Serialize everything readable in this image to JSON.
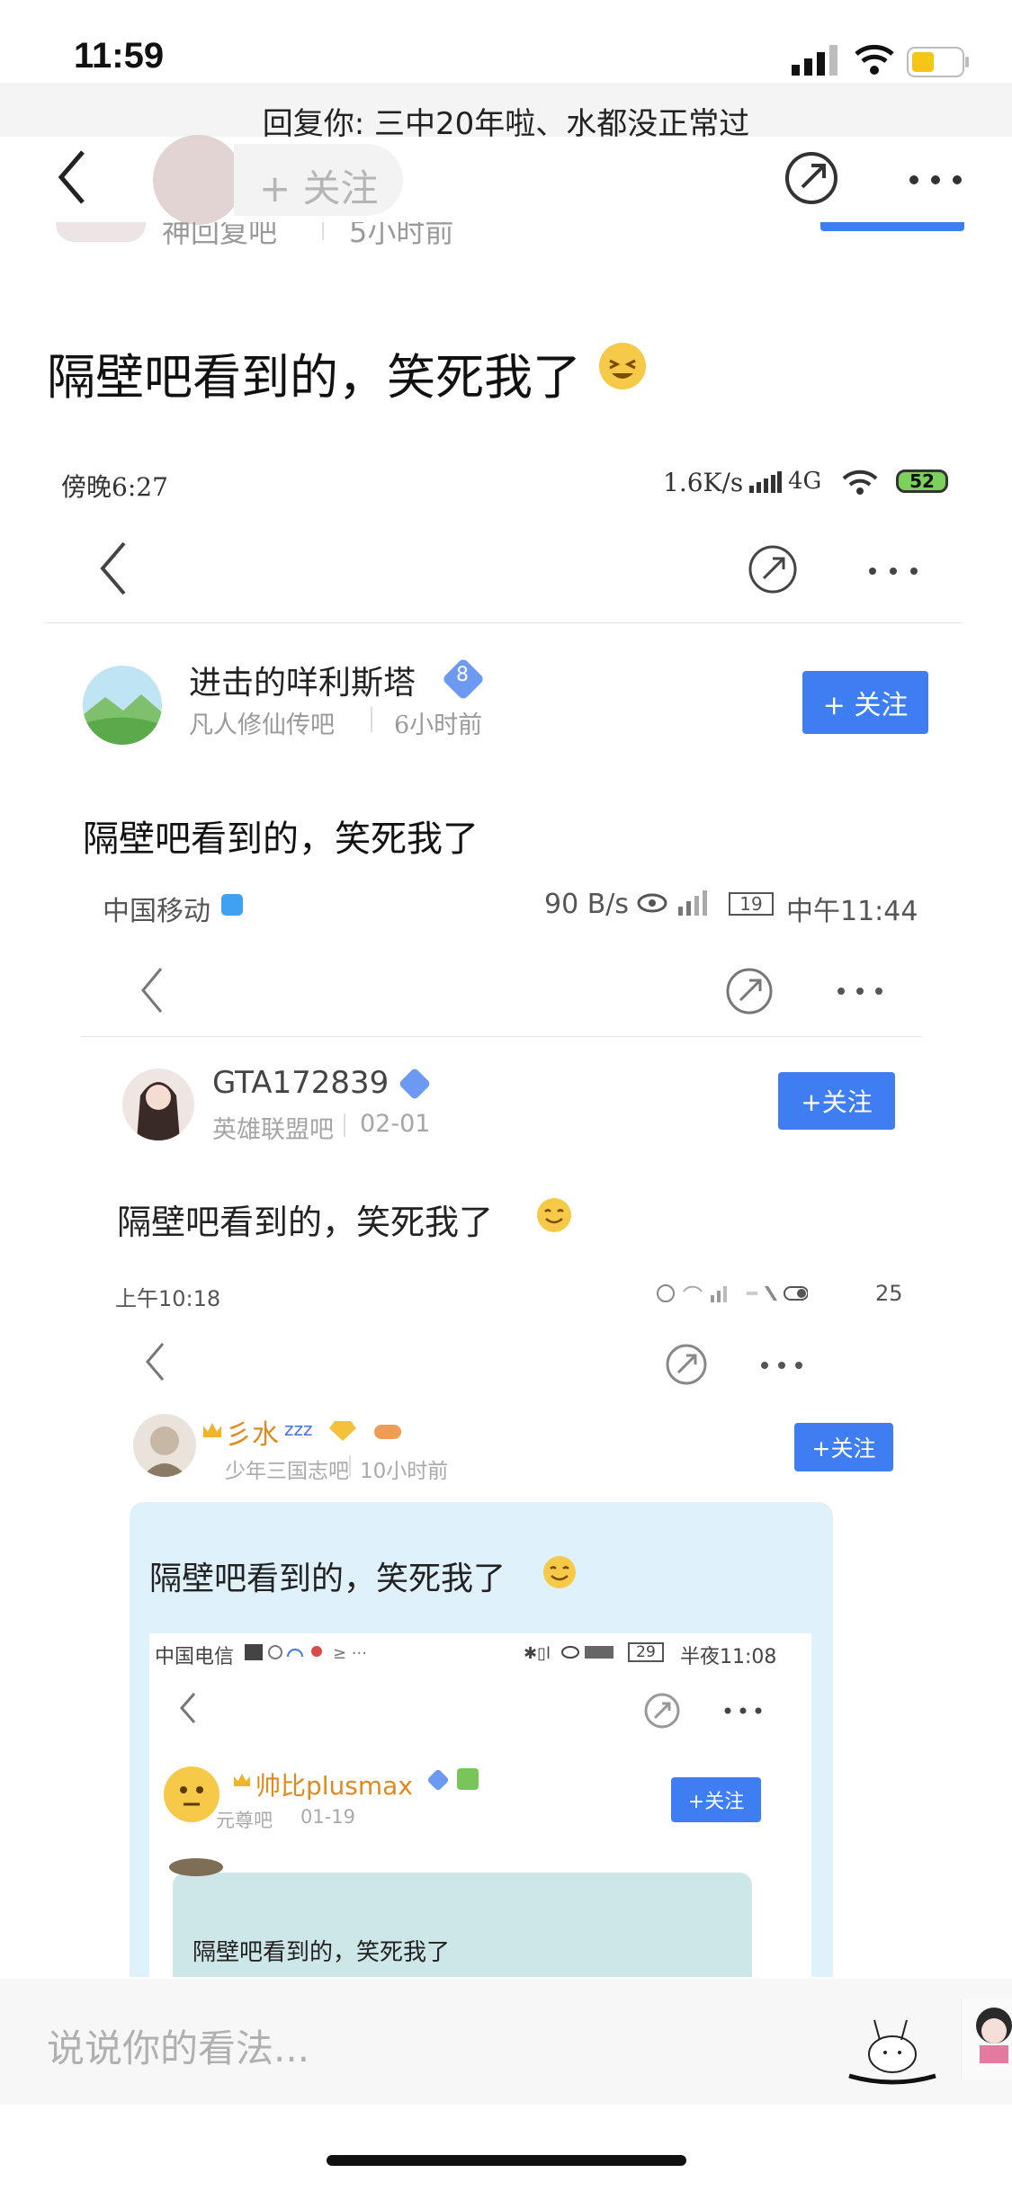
{
  "status_bar": {
    "time": "11:59"
  },
  "header": {
    "reply_banner": "回复你: 三中20年啦、水都没正常过",
    "follow_label": "+ 关注",
    "under_meta_forum": "神回复吧",
    "under_meta_time": "5小时前"
  },
  "post": {
    "title": "隔壁吧看到的，笑死我了"
  },
  "shot1": {
    "status_time": "傍晚6:27",
    "status_right": "1.6K/s",
    "status_network": "4G",
    "battery": "52",
    "username": "进击的咩利斯塔",
    "level": "8",
    "forum": "凡人修仙传吧",
    "time": "6小时前",
    "follow_label": "+ 关注",
    "text": "隔壁吧看到的，笑死我了"
  },
  "shot2": {
    "carrier": "中国移动",
    "speed": "90 B/s",
    "battery": "19",
    "time": "中午11:44",
    "username": "GTA172839",
    "forum": "英雄联盟吧",
    "date": "02-01",
    "follow_label": "+关注",
    "text": "隔壁吧看到的，笑死我了"
  },
  "shot3": {
    "time": "上午10:18",
    "battery": "25",
    "username": "彡水",
    "forum": "少年三国志吧",
    "post_time": "10小时前",
    "follow_label": "+关注",
    "text": "隔壁吧看到的，笑死我了"
  },
  "shot4": {
    "carrier": "中国电信",
    "battery": "29",
    "time": "半夜11:08",
    "username": "帅比plusmax",
    "forum": "元尊吧",
    "date": "01-19",
    "follow_label": "+关注",
    "text": "隔壁吧看到的，笑死我了"
  },
  "comment_bar": {
    "placeholder": "说说你的看法..."
  },
  "colors": {
    "accent": "#3e7df2",
    "battery_yellow": "#f5c518"
  }
}
